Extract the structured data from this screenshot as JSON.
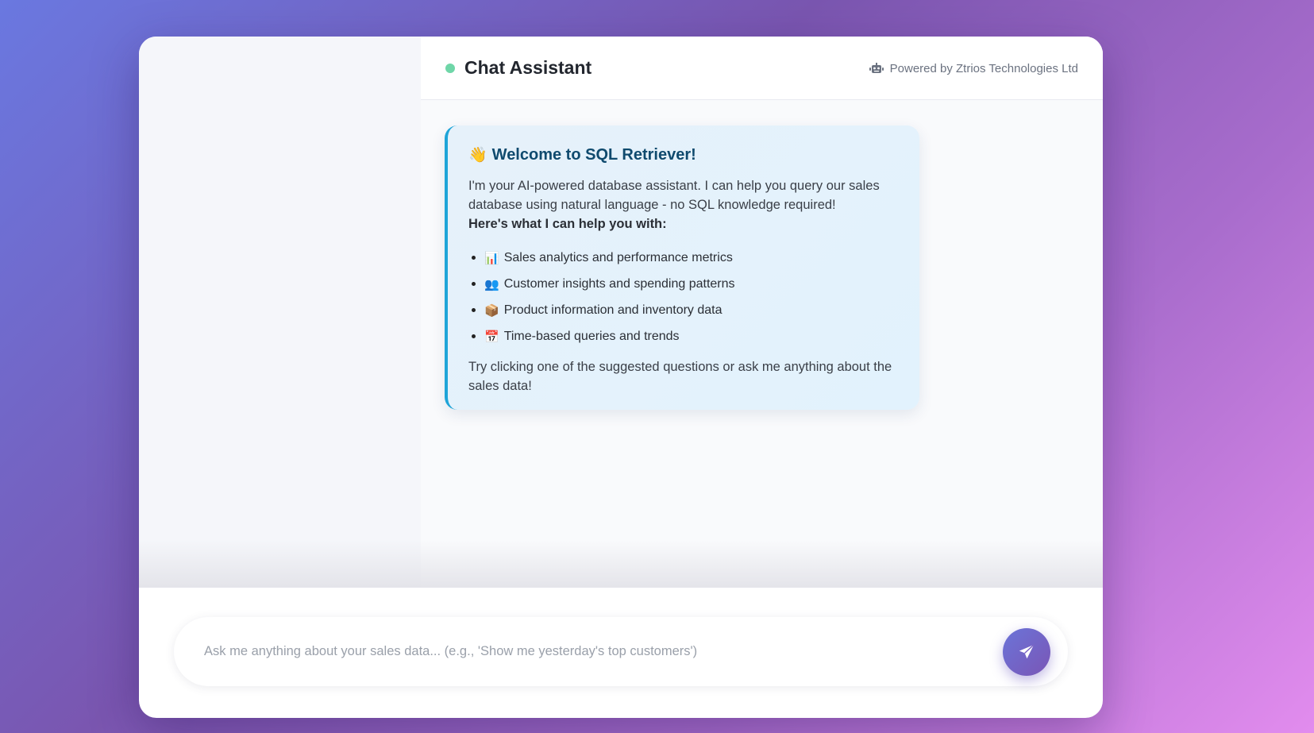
{
  "header": {
    "title": "Chat Assistant",
    "powered_by": "Powered by Ztrios Technologies Ltd",
    "status_color": "#6fd6a8"
  },
  "welcome": {
    "emoji": "👋",
    "title": "Welcome to SQL Retriever!",
    "intro": "I'm your AI-powered database assistant. I can help you query our sales database using natural language - no SQL knowledge required!",
    "help_heading": "Here's what I can help you with:",
    "features": [
      {
        "emoji": "📊",
        "label": "Sales analytics and performance metrics"
      },
      {
        "emoji": "👥",
        "label": "Customer insights and spending patterns"
      },
      {
        "emoji": "📦",
        "label": "Product information and inventory data"
      },
      {
        "emoji": "📅",
        "label": "Time-based queries and trends"
      }
    ],
    "outro": "Try clicking one of the suggested questions or ask me anything about the sales data!"
  },
  "composer": {
    "placeholder": "Ask me anything about your sales data... (e.g., 'Show me yesterday's top customers')",
    "value": ""
  },
  "icons": {
    "header": "robot-icon",
    "send": "send-icon"
  },
  "colors": {
    "accent": "#1ea4d8",
    "send_gradient_start": "#6b74d8",
    "send_gradient_end": "#7a56b6"
  }
}
